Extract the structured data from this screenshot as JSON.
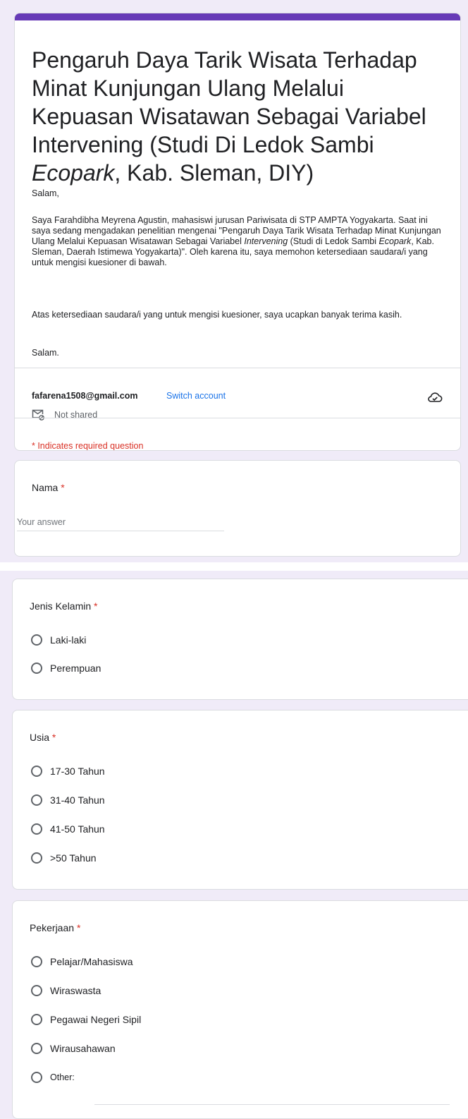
{
  "header": {
    "title": "Pengaruh Daya Tarik Wisata Terhadap Minat Kunjungan Ulang Melalui Kepuasan Wisatawan Sebagai Variabel Intervening (Studi Di Ledok Sambi Ecopark, Kab. Sleman, DIY)",
    "greeting": "Salam,",
    "paragraph1": "Saya Farahdibha Meyrena Agustin, mahasiswi jurusan Pariwisata di STP AMPTA Yogyakarta. Saat ini saya sedang mengadakan penelitian mengenai \"Pengaruh Daya Tarik Wisata Terhadap Minat Kunjungan Ulang Melalui Kepuasan Wisatawan Sebagai Variabel Intervening (Studi di Ledok Sambi Ecopark, Kab. Sleman, Daerah Istimewa Yogyakarta)\". Oleh karena itu, saya memohon ketersediaan saudara/i yang  untuk mengisi kuesioner di bawah.",
    "paragraph2": "Atas ketersediaan saudara/i yang untuk mengisi kuesioner, saya ucapkan banyak terima kasih.",
    "closing": "Salam."
  },
  "account": {
    "email": "fafarena1508@gmail.com",
    "switch_label": "Switch account",
    "not_shared": "Not shared",
    "required_note": "* Indicates required question"
  },
  "questions": {
    "nama": {
      "label": "Nama",
      "required_mark": "*",
      "placeholder": "Your answer"
    },
    "jenis_kelamin": {
      "label": "Jenis Kelamin",
      "required_mark": "*",
      "options": [
        "Laki-laki",
        "Perempuan"
      ]
    },
    "usia": {
      "label": "Usia",
      "required_mark": "*",
      "options": [
        "17-30 Tahun",
        "31-40 Tahun",
        "41-50 Tahun",
        ">50 Tahun"
      ]
    },
    "pekerjaan": {
      "label": "Pekerjaan",
      "required_mark": "*",
      "options": [
        "Pelajar/Mahasiswa",
        "Wiraswasta",
        "Pegawai Negeri Sipil",
        "Wirausahawan",
        "Other:"
      ]
    }
  },
  "colors": {
    "theme": "#673ab7",
    "background": "#f0ebf8",
    "required": "#d93025",
    "link": "#1a73e8"
  },
  "icons": {
    "cloud": "cloud-done-icon",
    "not_shared": "mail-not-shared-icon"
  }
}
